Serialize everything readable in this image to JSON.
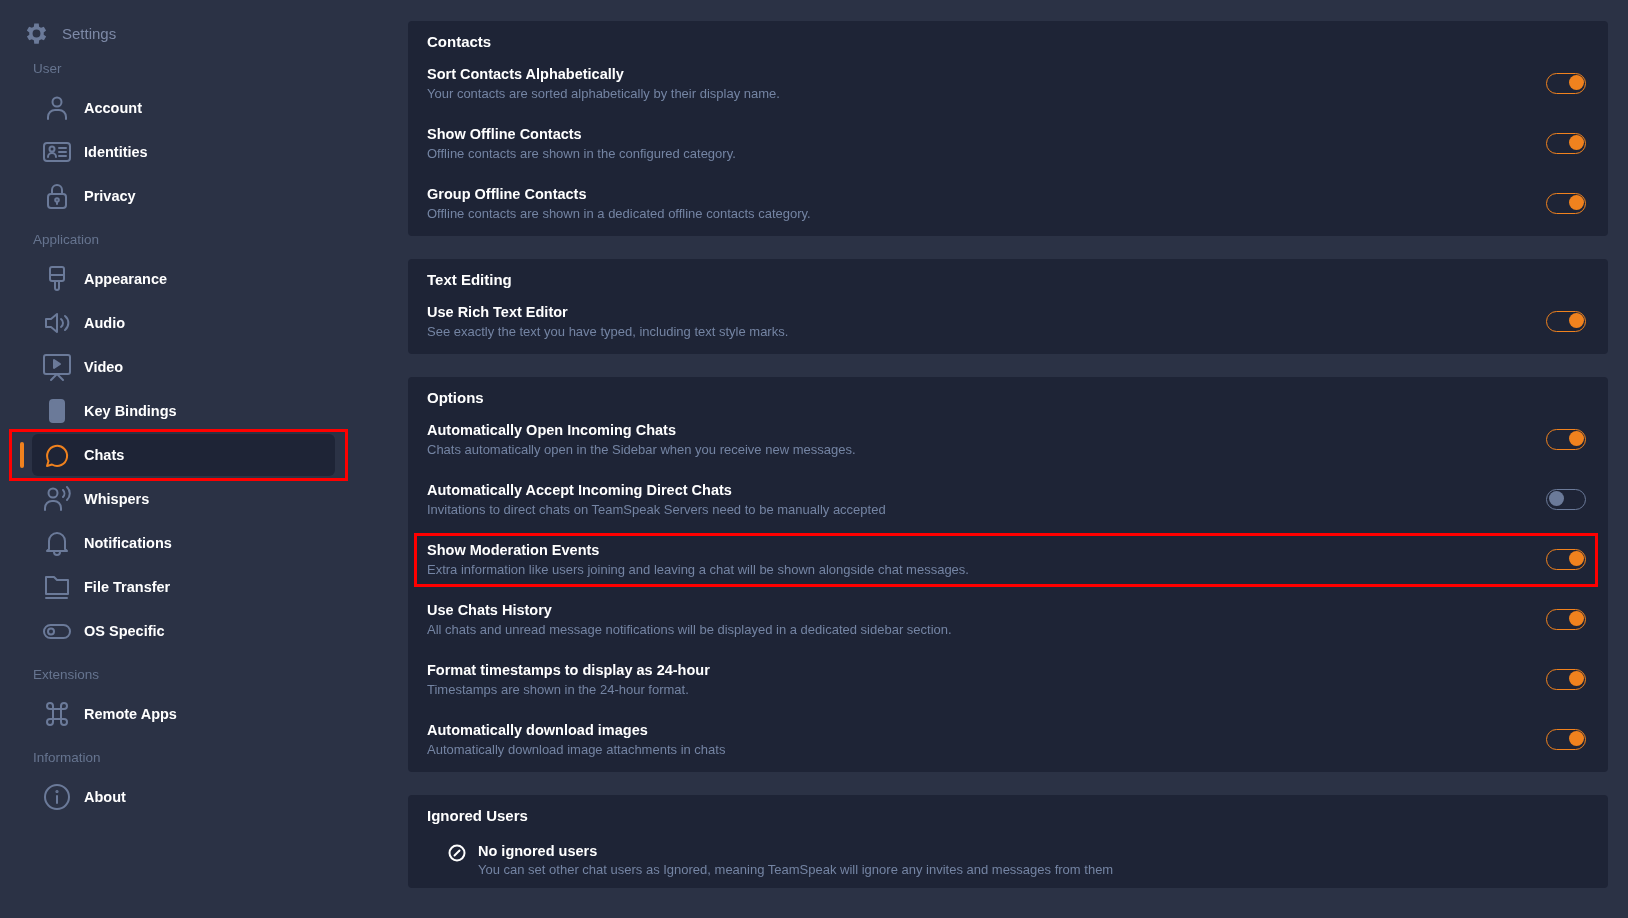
{
  "sidebar": {
    "title": "Settings",
    "groups": [
      {
        "label": "User",
        "items": [
          {
            "label": "Account",
            "selected": false,
            "highlighted": false
          },
          {
            "label": "Identities",
            "selected": false,
            "highlighted": false
          },
          {
            "label": "Privacy",
            "selected": false,
            "highlighted": false
          }
        ]
      },
      {
        "label": "Application",
        "items": [
          {
            "label": "Appearance",
            "selected": false,
            "highlighted": false
          },
          {
            "label": "Audio",
            "selected": false,
            "highlighted": false
          },
          {
            "label": "Video",
            "selected": false,
            "highlighted": false
          },
          {
            "label": "Key Bindings",
            "selected": false,
            "highlighted": false
          },
          {
            "label": "Chats",
            "selected": true,
            "highlighted": true
          },
          {
            "label": "Whispers",
            "selected": false,
            "highlighted": false
          },
          {
            "label": "Notifications",
            "selected": false,
            "highlighted": false
          },
          {
            "label": "File Transfer",
            "selected": false,
            "highlighted": false
          },
          {
            "label": "OS Specific",
            "selected": false,
            "highlighted": false
          }
        ]
      },
      {
        "label": "Extensions",
        "items": [
          {
            "label": "Remote Apps",
            "selected": false,
            "highlighted": false
          }
        ]
      },
      {
        "label": "Information",
        "items": [
          {
            "label": "About",
            "selected": false,
            "highlighted": false
          }
        ]
      }
    ]
  },
  "sections": [
    {
      "kind": "toggles",
      "title": "Contacts",
      "settings": [
        {
          "title": "Sort Contacts Alphabetically",
          "description": "Your contacts are sorted alphabetically by their display name.",
          "on": true,
          "highlighted": false
        },
        {
          "title": "Show Offline Contacts",
          "description": "Offline contacts are shown in the configured category.",
          "on": true,
          "highlighted": false
        },
        {
          "title": "Group Offline Contacts",
          "description": "Offline contacts are shown in a dedicated offline contacts category.",
          "on": true,
          "highlighted": false
        }
      ]
    },
    {
      "kind": "toggles",
      "title": "Text Editing",
      "settings": [
        {
          "title": "Use Rich Text Editor",
          "description": "See exactly the text you have typed, including text style marks.",
          "on": true,
          "highlighted": false
        }
      ]
    },
    {
      "kind": "toggles",
      "title": "Options",
      "settings": [
        {
          "title": "Automatically Open Incoming Chats",
          "description": "Chats automatically open in the Sidebar when you receive new messages.",
          "on": true,
          "highlighted": false
        },
        {
          "title": "Automatically Accept Incoming Direct Chats",
          "description": "Invitations to direct chats on TeamSpeak Servers need to be manually accepted",
          "on": false,
          "highlighted": false
        },
        {
          "title": "Show Moderation Events",
          "description": "Extra information like users joining and leaving a chat will be shown alongside chat messages.",
          "on": true,
          "highlighted": true
        },
        {
          "title": "Use Chats History",
          "description": "All chats and unread message notifications will be displayed in a dedicated sidebar section.",
          "on": true,
          "highlighted": false
        },
        {
          "title": "Format timestamps to display as 24-hour",
          "description": "Timestamps are shown in the 24-hour format.",
          "on": true,
          "highlighted": false
        },
        {
          "title": "Automatically download images",
          "description": "Automatically download image attachments in chats",
          "on": true,
          "highlighted": false
        }
      ]
    },
    {
      "kind": "empty-list",
      "title": "Ignored Users",
      "empty_title": "No ignored users",
      "empty_text": "You can set other chat users as Ignored, meaning TeamSpeak will ignore any invites and messages from them"
    }
  ]
}
